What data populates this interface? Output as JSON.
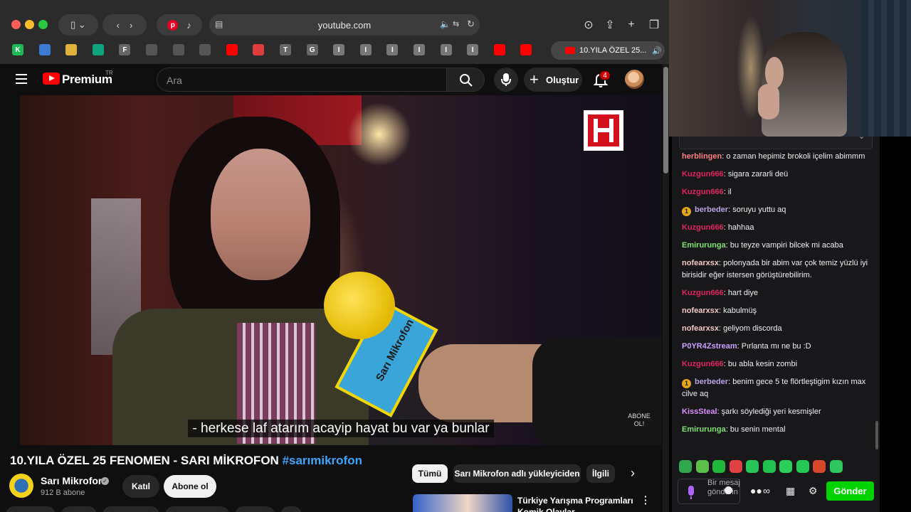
{
  "browser": {
    "address": "youtube.com",
    "active_tab_title": "10.YILA ÖZEL 25...",
    "favorites": [
      "K",
      "",
      "",
      "",
      "F",
      "",
      "",
      "",
      "",
      "",
      "T",
      "G",
      "I",
      "I",
      "I",
      "I",
      "I",
      "I",
      "",
      ""
    ]
  },
  "youtube": {
    "brand": "Premium",
    "region": "TR",
    "search_placeholder": "Ara",
    "create_label": "Oluştur",
    "notification_count": "4"
  },
  "video": {
    "subtitle": "- herkese laf atarım acayip hayat bu var ya bunlar",
    "watermark_text": "ABONE OL!",
    "mic_label": "Sarı Mikrofon",
    "title": "10.YILA ÖZEL 25 FENOMEN - SARI MİKROFON",
    "hashtag": "#sarımikrofon"
  },
  "channel": {
    "name": "Sarı Mikrofon",
    "subscribers": "912 B abone",
    "join_label": "Katıl",
    "subscribe_label": "Abone ol"
  },
  "chips": [
    "Tümü",
    "Sarı Mikrofon adlı yükleyiciden",
    "İlgili"
  ],
  "recommendation": {
    "title": "Türkiye Yarışma Programları Komik Olaylar"
  },
  "chat": {
    "messages": [
      {
        "user": "herblingen",
        "color": "#ff7f7f",
        "badge": "",
        "text": "o zaman hepimiz brokoli içelim abimmm"
      },
      {
        "user": "Kuzgun666",
        "color": "#e0245e",
        "badge": "",
        "text": "sigara zararli deü"
      },
      {
        "user": "Kuzgun666",
        "color": "#e0245e",
        "badge": "",
        "text": "il"
      },
      {
        "user": "berbeder",
        "color": "#b9a3e3",
        "badge": "1",
        "text": "soruyu yuttu aq"
      },
      {
        "user": "Kuzgun666",
        "color": "#e0245e",
        "badge": "",
        "text": "hahhaa"
      },
      {
        "user": "Emirurunga",
        "color": "#7ee36e",
        "badge": "",
        "text": "bu teyze vampiri bilcek mi acaba"
      },
      {
        "user": "nofearxsx",
        "color": "#f4c7c7",
        "badge": "",
        "text": "polonyada bir abim var çok temiz yüzlü iyi birisidir eğer istersen görüştürebilirim."
      },
      {
        "user": "Kuzgun666",
        "color": "#e0245e",
        "badge": "",
        "text": "hart diye"
      },
      {
        "user": "nofearxsx",
        "color": "#f4c7c7",
        "badge": "",
        "text": "kabulmüş"
      },
      {
        "user": "nofearxsx",
        "color": "#f4c7c7",
        "badge": "",
        "text": "geliyom discorda"
      },
      {
        "user": "P0YR4Zstream",
        "color": "#c9a0ff",
        "badge": "",
        "text": "Pırlanta mı ne bu :D"
      },
      {
        "user": "Kuzgun666",
        "color": "#e0245e",
        "badge": "",
        "text": "bu abla kesin zombi"
      },
      {
        "user": "berbeder",
        "color": "#b9a3e3",
        "badge": "1",
        "text": "benim gece 5 te flörtleştigim kızın max cilve aq"
      },
      {
        "user": "KissSteal",
        "color": "#e08cff",
        "badge": "",
        "text": "şarkı söylediği yeri kesmişler"
      },
      {
        "user": "Emirurunga",
        "color": "#7ee36e",
        "badge": "",
        "text": "bu senin mental"
      }
    ],
    "input_placeholder": "Bir mesaj gönderin",
    "send_label": "Gönder",
    "emote_colors": [
      "#2fa84f",
      "#5bbf4a",
      "#1fb83a",
      "#e04242",
      "#28c65a",
      "#22c24f",
      "#2bcf5c",
      "#26c955",
      "#d9482b",
      "#2fc760"
    ]
  }
}
